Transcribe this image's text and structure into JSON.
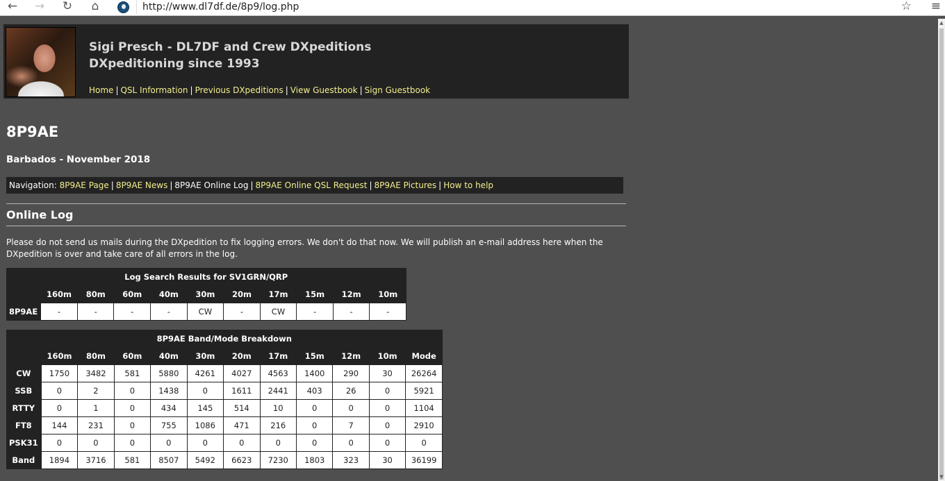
{
  "browser": {
    "url": "http://www.dl7df.de/8p9/log.php",
    "back_icon": "←",
    "forward_icon": "→",
    "reload_icon": "↻",
    "home_icon": "⌂",
    "star_icon": "☆",
    "menu_icon": "≡"
  },
  "header": {
    "title_line1": "Sigi Presch - DL7DF and Crew DXpeditions",
    "title_line2": "DXpeditioning since 1993",
    "nav": [
      "Home",
      "QSL Information",
      "Previous DXpeditions",
      "View Guestbook",
      "Sign Guestbook"
    ],
    "separator": "|"
  },
  "page": {
    "title": "8P9AE",
    "subtitle": "Barbados - November 2018",
    "subnav_prefix": "Navigation:",
    "subnav": [
      {
        "label": "8P9AE Page",
        "link": true
      },
      {
        "label": "8P9AE News",
        "link": true
      },
      {
        "label": "8P9AE Online Log",
        "link": false
      },
      {
        "label": "8P9AE Online QSL Request",
        "link": true
      },
      {
        "label": "8P9AE Pictures",
        "link": true
      },
      {
        "label": "How to help",
        "link": true
      }
    ],
    "section_title": "Online Log",
    "notice": "Please do not send us mails during the DXpedition to fix logging errors. We don't do that now. We will publish an e-mail address here when the DXpedition is over and take care of all errors in the log."
  },
  "search_results": {
    "title": "Log Search Results for SV1GRN/QRP",
    "bands": [
      "160m",
      "80m",
      "60m",
      "40m",
      "30m",
      "20m",
      "17m",
      "15m",
      "12m",
      "10m"
    ],
    "rows": [
      {
        "label": "8P9AE",
        "cells": [
          "-",
          "-",
          "-",
          "-",
          "CW",
          "-",
          "CW",
          "-",
          "-",
          "-"
        ]
      }
    ]
  },
  "breakdown": {
    "title": "8P9AE Band/Mode Breakdown",
    "columns": [
      "160m",
      "80m",
      "60m",
      "40m",
      "30m",
      "20m",
      "17m",
      "15m",
      "12m",
      "10m",
      "Mode"
    ],
    "rows": [
      {
        "label": "CW",
        "cells": [
          "1750",
          "3482",
          "581",
          "5880",
          "4261",
          "4027",
          "4563",
          "1400",
          "290",
          "30",
          "26264"
        ]
      },
      {
        "label": "SSB",
        "cells": [
          "0",
          "2",
          "0",
          "1438",
          "0",
          "1611",
          "2441",
          "403",
          "26",
          "0",
          "5921"
        ]
      },
      {
        "label": "RTTY",
        "cells": [
          "0",
          "1",
          "0",
          "434",
          "145",
          "514",
          "10",
          "0",
          "0",
          "0",
          "1104"
        ]
      },
      {
        "label": "FT8",
        "cells": [
          "144",
          "231",
          "0",
          "755",
          "1086",
          "471",
          "216",
          "0",
          "7",
          "0",
          "2910"
        ]
      },
      {
        "label": "PSK31",
        "cells": [
          "0",
          "0",
          "0",
          "0",
          "0",
          "0",
          "0",
          "0",
          "0",
          "0",
          "0"
        ]
      },
      {
        "label": "Band",
        "cells": [
          "1894",
          "3716",
          "581",
          "8507",
          "5492",
          "6623",
          "7230",
          "1803",
          "323",
          "30",
          "36199"
        ]
      }
    ]
  }
}
